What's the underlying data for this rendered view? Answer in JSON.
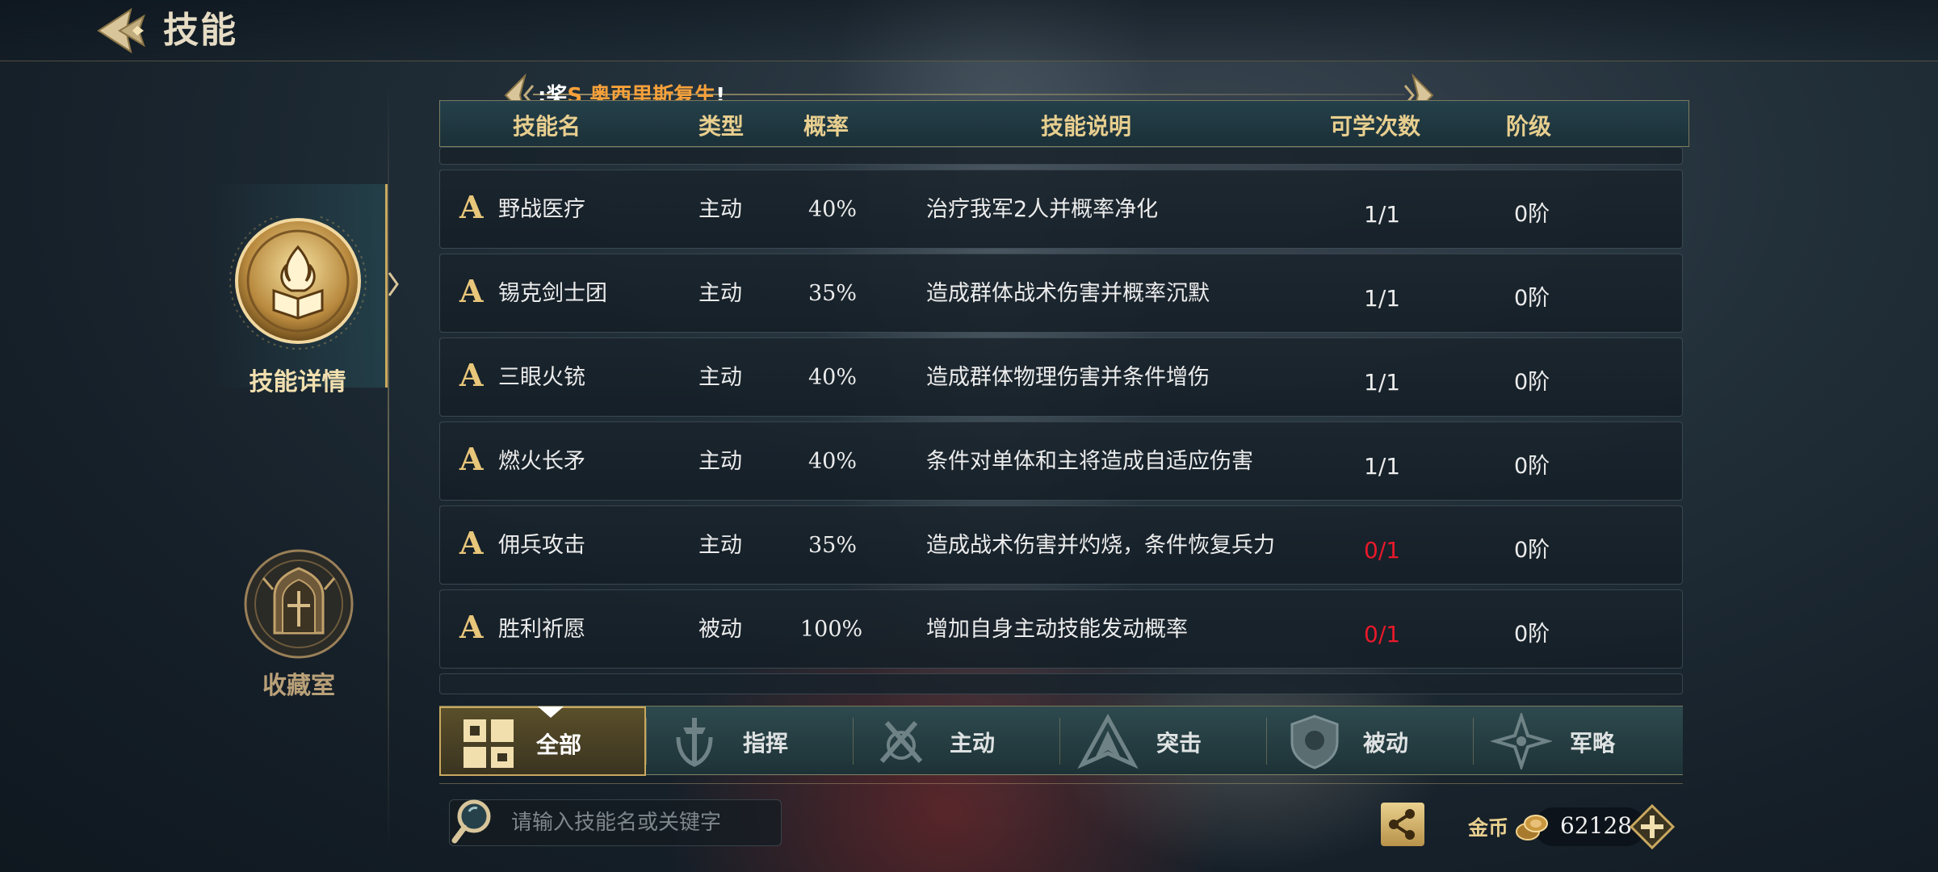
{
  "header": {
    "title": "技能"
  },
  "sidebar": {
    "items": [
      {
        "label": "技能详情",
        "active": true
      },
      {
        "label": "收藏室",
        "active": false
      }
    ]
  },
  "marquee": {
    "prefix": ":奖",
    "highlight": "S 奥西里斯复生",
    "suffix": "!"
  },
  "table": {
    "columns": [
      "技能名",
      "类型",
      "概率",
      "技能说明",
      "可学次数",
      "阶级"
    ],
    "rows": [
      {
        "grade": "A",
        "name": "野战医疗",
        "type": "主动",
        "rate": "40%",
        "desc": "治疗我军2人并概率净化",
        "learn": "1/1",
        "learn_color": "#ffffff",
        "tier": "0阶"
      },
      {
        "grade": "A",
        "name": "锡克剑士团",
        "type": "主动",
        "rate": "35%",
        "desc": "造成群体战术伤害并概率沉默",
        "learn": "1/1",
        "learn_color": "#ffffff",
        "tier": "0阶"
      },
      {
        "grade": "A",
        "name": "三眼火铳",
        "type": "主动",
        "rate": "40%",
        "desc": "造成群体物理伤害并条件增伤",
        "learn": "1/1",
        "learn_color": "#ffffff",
        "tier": "0阶"
      },
      {
        "grade": "A",
        "name": "燃火长矛",
        "type": "主动",
        "rate": "40%",
        "desc": "条件对单体和主将造成自适应伤害",
        "learn": "1/1",
        "learn_color": "#ffffff",
        "tier": "0阶"
      },
      {
        "grade": "A",
        "name": "佣兵攻击",
        "type": "主动",
        "rate": "35%",
        "desc": "造成战术伤害并灼烧，条件恢复兵力",
        "learn": "0/1",
        "learn_color": "#e8192b",
        "tier": "0阶"
      },
      {
        "grade": "A",
        "name": "胜利祈愿",
        "type": "被动",
        "rate": "100%",
        "desc": "增加自身主动技能发动概率",
        "learn": "0/1",
        "learn_color": "#e8192b",
        "tier": "0阶"
      }
    ]
  },
  "tabs": [
    {
      "label": "全部",
      "icon": "grid-icon",
      "active": true
    },
    {
      "label": "指挥",
      "icon": "command-icon",
      "active": false
    },
    {
      "label": "主动",
      "icon": "active-icon",
      "active": false
    },
    {
      "label": "突击",
      "icon": "assault-icon",
      "active": false
    },
    {
      "label": "被动",
      "icon": "passive-icon",
      "active": false
    },
    {
      "label": "军略",
      "icon": "strategy-icon",
      "active": false
    }
  ],
  "search": {
    "placeholder": "请输入技能名或关键字",
    "value": ""
  },
  "currency": {
    "label": "金币",
    "value": "62128"
  },
  "colors": {
    "gold": "#c9a85f",
    "header_text": "#e8cf8f",
    "red": "#e8192b",
    "orange": "#f7a13a"
  }
}
